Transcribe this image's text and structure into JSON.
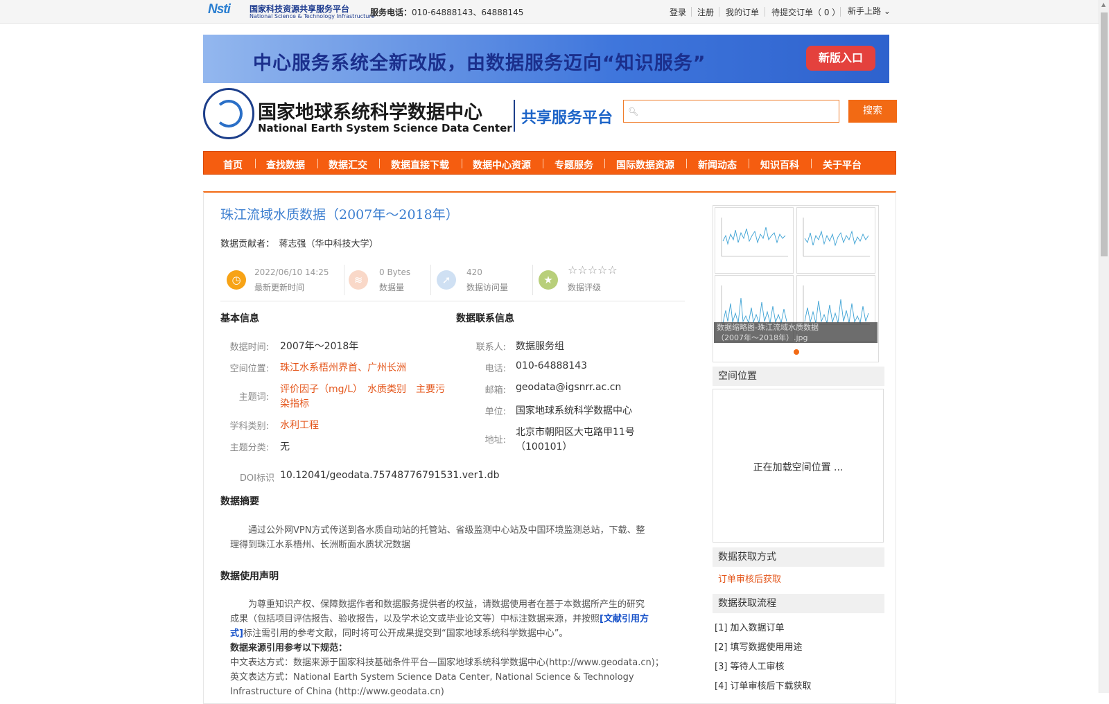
{
  "topbar": {
    "logo_brand": "Nsti",
    "logo_cn": "国家科技资源共享服务平台",
    "logo_en": "National Science & Technology Infrastructure",
    "phone_label": "服务电话：",
    "phone_value": "010-64888143、64888145",
    "login": "登录",
    "register": "注册",
    "my_orders": "我的订单",
    "pending_orders": "待提交订单（ 0 ）",
    "guide": "新手上路"
  },
  "banner": {
    "text": "中心服务系统全新改版，由数据服务迈向“知识服务”",
    "button": "新版入口"
  },
  "header": {
    "site_name": "国家地球系统科学数据中心",
    "site_name_en": "National Earth System Science Data Center",
    "platform": "共享服务平台",
    "search_placeholder": "",
    "search_button": "搜索"
  },
  "nav": [
    "首页",
    "查找数据",
    "数据汇交",
    "数据直接下载",
    "数据中心资源",
    "专题服务",
    "国际数据资源",
    "新闻动态",
    "知识百科",
    "关于平台"
  ],
  "dataset": {
    "title": "珠江流域水质数据（2007年～2018年）",
    "contributor_label": "数据贡献者：",
    "contributor": "蒋志强（华中科技大学）",
    "stats": {
      "updated_value": "2022/06/10 14:25",
      "updated_label": "最新更新时间",
      "size_value": "0 Bytes",
      "size_label": "数据量",
      "visits_value": "420",
      "visits_label": "数据访问量",
      "rating_stars": "☆☆☆☆☆",
      "rating_label": "数据评级"
    },
    "basic": {
      "heading": "基本信息",
      "time_label": "数据时间:",
      "time": "2007年～2018年",
      "space_label": "空间位置:",
      "space": "珠江水系梧州界首、广州长洲",
      "keywords_label": "主题词:",
      "keywords_line1": "评价因子（mg/L）　水质类别　主要污",
      "keywords_line2": "染指标",
      "discipline_label": "学科类别:",
      "discipline": "水利工程",
      "category_label": "主题分类:",
      "category": "无",
      "doi_label": "DOI标识",
      "doi": "10.12041/geodata.75748776791531.ver1.db"
    },
    "contact": {
      "heading": "数据联系信息",
      "person_label": "联系人:",
      "person": "数据服务组",
      "phone_label": "电话:",
      "phone": "010-64888143",
      "email_label": "邮箱:",
      "email": "geodata@igsnrr.ac.cn",
      "unit_label": "单位:",
      "unit": "国家地球系统科学数据中心",
      "address_label": "地址:",
      "address_line1": "北京市朝阳区大屯路甲11号",
      "address_line2": "（100101）"
    },
    "abstract": {
      "heading": "数据摘要",
      "line1": "　　通过公外网VPN方式传送到各水质自动站的托管站、省级监测中心站及中国环境监测总站，下载、整",
      "line2": "理得到珠江水系梧州、长洲断面水质状况数据"
    },
    "usage": {
      "heading": "数据使用声明",
      "line1": "　　为尊重知识产权、保障数据作者和数据服务提供者的权益，请数据使用者在基于本数据所产生的研究",
      "line2": "成果（包括项目评估报告、验收报告，以及学术论文或毕业论文等）中标注数据来源，并按照",
      "link_part1": "[文献引用方",
      "link_part2": "式]",
      "line3_rest": "标注需引用的参考文献，同时将可公开成果提交到“国家地球系统科学数据中心”。",
      "cite_heading": "数据来源引用参考以下规范：",
      "cite_cn": "中文表达方式：数据来源于国家科技基础条件平台—国家地球系统科学数据中心(http://www.geodata.cn)；",
      "cite_en1": "英文表达方式：National Earth System Science Data Center, National Science & Technology",
      "cite_en2": "Infrastructure of China (http://www.geodata.cn)"
    }
  },
  "sidebar": {
    "image_caption_line1": "数据缩略图-珠江流域水质数据",
    "image_caption_line2": "（2007年～2018年）.jpg",
    "spatial_heading": "空间位置",
    "spatial_loading": "正在加载空间位置 ...",
    "access_heading": "数据获取方式",
    "access_method": "订单审核后获取",
    "process_heading": "数据获取流程",
    "steps": [
      "[1] 加入数据订单",
      "[2] 填写数据使用用途",
      "[3] 等待人工审核",
      "[4] 订单审核后下载获取"
    ]
  },
  "colors": {
    "accent": "#f26a14",
    "title_blue": "#3d7fd0",
    "link_orange": "#e4551a"
  }
}
